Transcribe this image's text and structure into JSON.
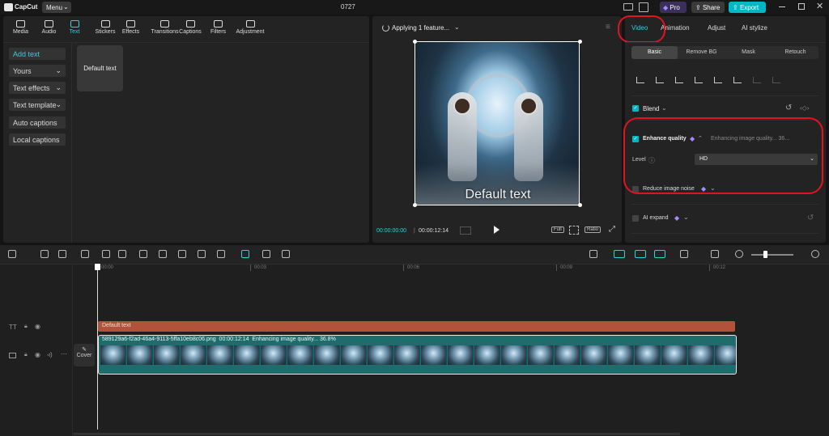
{
  "app": {
    "logo": "CapCut",
    "menu": "Menu",
    "project": "0727",
    "pro": "Pro",
    "share": "Share",
    "export": "Export"
  },
  "toolbar": [
    {
      "label": "Media",
      "icon": "media-icon"
    },
    {
      "label": "Audio",
      "icon": "audio-icon"
    },
    {
      "label": "Text",
      "icon": "text-icon",
      "active": true
    },
    {
      "label": "Stickers",
      "icon": "stickers-icon"
    },
    {
      "label": "Effects",
      "icon": "effects-icon"
    },
    {
      "label": "Transitions",
      "icon": "transitions-icon"
    },
    {
      "label": "Captions",
      "icon": "captions-icon"
    },
    {
      "label": "Filters",
      "icon": "filters-icon"
    },
    {
      "label": "Adjustment",
      "icon": "adjustment-icon"
    }
  ],
  "left_menu": {
    "add_text": "Add text",
    "yours": "Yours",
    "text_effects": "Text effects",
    "text_template": "Text template",
    "auto_captions": "Auto captions",
    "local_captions": "Local captions",
    "default_text_card": "Default text"
  },
  "player": {
    "status": "Applying 1 feature...",
    "overlay_text": "Default text",
    "current_time": "00:00:00:00",
    "total_time": "00:00:12:14",
    "full": "Full",
    "ratio": "Ratio"
  },
  "inspector": {
    "tabs": [
      "Video",
      "Animation",
      "Adjust",
      "AI stylize"
    ],
    "subtabs": [
      "Basic",
      "Remove BG",
      "Mask",
      "Retouch"
    ],
    "blend": "Blend",
    "enhance_quality": "Enhance quality",
    "enhance_status": "Enhancing image quality... 36...",
    "level_label": "Level",
    "level_value": "HD",
    "reduce_noise": "Reduce image noise",
    "ai_expand": "AI expand"
  },
  "timeline": {
    "ruler": [
      "00:00",
      "00:03",
      "00:06",
      "00:09",
      "00:12"
    ],
    "text_clip": "Default text",
    "video_clip_name": "589129a6-f2ad-46a4-9113-5ffa10eb8c06.png",
    "video_clip_duration": "00:00:12:14",
    "video_clip_status": "Enhancing image quality... 36.8%",
    "cover": "Cover"
  },
  "colors": {
    "accent": "#00c2cf",
    "highlight_red": "#e0141e",
    "text_clip": "#b1533a",
    "video_clip": "#1e6c6c",
    "pro": "#8a6cff"
  }
}
